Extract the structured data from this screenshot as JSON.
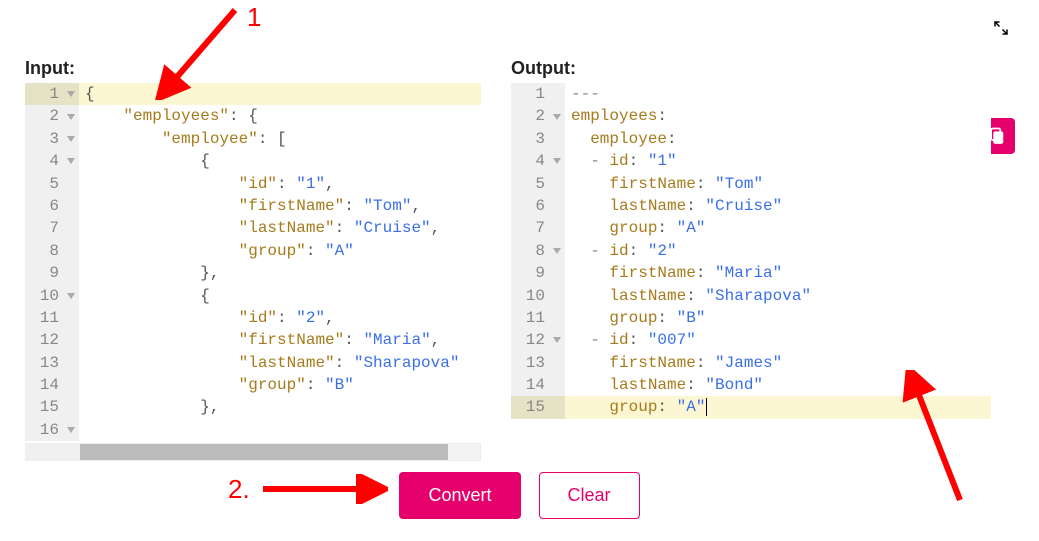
{
  "labels": {
    "input_title": "Input:",
    "output_title": "Output:",
    "convert": "Convert",
    "clear": "Clear"
  },
  "annotations": {
    "one": "1",
    "two": "2."
  },
  "input_editor": {
    "lines": [
      {
        "n": 1,
        "fold": true,
        "hl": true,
        "tokens": [
          [
            "punc",
            "{"
          ]
        ]
      },
      {
        "n": 2,
        "fold": true,
        "hl": false,
        "tokens": [
          [
            "ws",
            "    "
          ],
          [
            "key",
            "\"employees\""
          ],
          [
            "punc",
            ": {"
          ]
        ]
      },
      {
        "n": 3,
        "fold": true,
        "hl": false,
        "tokens": [
          [
            "ws",
            "        "
          ],
          [
            "key",
            "\"employee\""
          ],
          [
            "punc",
            ": ["
          ]
        ]
      },
      {
        "n": 4,
        "fold": true,
        "hl": false,
        "tokens": [
          [
            "ws",
            "            "
          ],
          [
            "punc",
            "{"
          ]
        ]
      },
      {
        "n": 5,
        "fold": false,
        "hl": false,
        "tokens": [
          [
            "ws",
            "                "
          ],
          [
            "key",
            "\"id\""
          ],
          [
            "punc",
            ": "
          ],
          [
            "str",
            "\"1\""
          ],
          [
            "punc",
            ","
          ]
        ]
      },
      {
        "n": 6,
        "fold": false,
        "hl": false,
        "tokens": [
          [
            "ws",
            "                "
          ],
          [
            "key",
            "\"firstName\""
          ],
          [
            "punc",
            ": "
          ],
          [
            "str",
            "\"Tom\""
          ],
          [
            "punc",
            ","
          ]
        ]
      },
      {
        "n": 7,
        "fold": false,
        "hl": false,
        "tokens": [
          [
            "ws",
            "                "
          ],
          [
            "key",
            "\"lastName\""
          ],
          [
            "punc",
            ": "
          ],
          [
            "str",
            "\"Cruise\""
          ],
          [
            "punc",
            ","
          ]
        ]
      },
      {
        "n": 8,
        "fold": false,
        "hl": false,
        "tokens": [
          [
            "ws",
            "                "
          ],
          [
            "key",
            "\"group\""
          ],
          [
            "punc",
            ": "
          ],
          [
            "str",
            "\"A\""
          ]
        ]
      },
      {
        "n": 9,
        "fold": false,
        "hl": false,
        "tokens": [
          [
            "ws",
            "            "
          ],
          [
            "punc",
            "},"
          ]
        ]
      },
      {
        "n": 10,
        "fold": true,
        "hl": false,
        "tokens": [
          [
            "ws",
            "            "
          ],
          [
            "punc",
            "{"
          ]
        ]
      },
      {
        "n": 11,
        "fold": false,
        "hl": false,
        "tokens": [
          [
            "ws",
            "                "
          ],
          [
            "key",
            "\"id\""
          ],
          [
            "punc",
            ": "
          ],
          [
            "str",
            "\"2\""
          ],
          [
            "punc",
            ","
          ]
        ]
      },
      {
        "n": 12,
        "fold": false,
        "hl": false,
        "tokens": [
          [
            "ws",
            "                "
          ],
          [
            "key",
            "\"firstName\""
          ],
          [
            "punc",
            ": "
          ],
          [
            "str",
            "\"Maria\""
          ],
          [
            "punc",
            ","
          ]
        ]
      },
      {
        "n": 13,
        "fold": false,
        "hl": false,
        "tokens": [
          [
            "ws",
            "                "
          ],
          [
            "key",
            "\"lastName\""
          ],
          [
            "punc",
            ": "
          ],
          [
            "str",
            "\"Sharapova\""
          ]
        ]
      },
      {
        "n": 14,
        "fold": false,
        "hl": false,
        "tokens": [
          [
            "ws",
            "                "
          ],
          [
            "key",
            "\"group\""
          ],
          [
            "punc",
            ": "
          ],
          [
            "str",
            "\"B\""
          ]
        ]
      },
      {
        "n": 15,
        "fold": false,
        "hl": false,
        "tokens": [
          [
            "ws",
            "            "
          ],
          [
            "punc",
            "},"
          ]
        ]
      },
      {
        "n": 16,
        "fold": true,
        "hl": false,
        "tokens": []
      }
    ]
  },
  "output_editor": {
    "lines": [
      {
        "n": 1,
        "fold": false,
        "hl": false,
        "tokens": [
          [
            "dash",
            "---"
          ]
        ]
      },
      {
        "n": 2,
        "fold": true,
        "hl": false,
        "tokens": [
          [
            "key",
            "employees"
          ],
          [
            "punc",
            ":"
          ]
        ]
      },
      {
        "n": 3,
        "fold": false,
        "hl": false,
        "tokens": [
          [
            "ws",
            "  "
          ],
          [
            "key",
            "employee"
          ],
          [
            "punc",
            ":"
          ]
        ]
      },
      {
        "n": 4,
        "fold": true,
        "hl": false,
        "tokens": [
          [
            "ws",
            "  "
          ],
          [
            "dash",
            "- "
          ],
          [
            "key",
            "id"
          ],
          [
            "punc",
            ": "
          ],
          [
            "str",
            "\"1\""
          ]
        ]
      },
      {
        "n": 5,
        "fold": false,
        "hl": false,
        "tokens": [
          [
            "ws",
            "    "
          ],
          [
            "key",
            "firstName"
          ],
          [
            "punc",
            ": "
          ],
          [
            "str",
            "\"Tom\""
          ]
        ]
      },
      {
        "n": 6,
        "fold": false,
        "hl": false,
        "tokens": [
          [
            "ws",
            "    "
          ],
          [
            "key",
            "lastName"
          ],
          [
            "punc",
            ": "
          ],
          [
            "str",
            "\"Cruise\""
          ]
        ]
      },
      {
        "n": 7,
        "fold": false,
        "hl": false,
        "tokens": [
          [
            "ws",
            "    "
          ],
          [
            "key",
            "group"
          ],
          [
            "punc",
            ": "
          ],
          [
            "str",
            "\"A\""
          ]
        ]
      },
      {
        "n": 8,
        "fold": true,
        "hl": false,
        "tokens": [
          [
            "ws",
            "  "
          ],
          [
            "dash",
            "- "
          ],
          [
            "key",
            "id"
          ],
          [
            "punc",
            ": "
          ],
          [
            "str",
            "\"2\""
          ]
        ]
      },
      {
        "n": 9,
        "fold": false,
        "hl": false,
        "tokens": [
          [
            "ws",
            "    "
          ],
          [
            "key",
            "firstName"
          ],
          [
            "punc",
            ": "
          ],
          [
            "str",
            "\"Maria\""
          ]
        ]
      },
      {
        "n": 10,
        "fold": false,
        "hl": false,
        "tokens": [
          [
            "ws",
            "    "
          ],
          [
            "key",
            "lastName"
          ],
          [
            "punc",
            ": "
          ],
          [
            "str",
            "\"Sharapova\""
          ]
        ]
      },
      {
        "n": 11,
        "fold": false,
        "hl": false,
        "tokens": [
          [
            "ws",
            "    "
          ],
          [
            "key",
            "group"
          ],
          [
            "punc",
            ": "
          ],
          [
            "str",
            "\"B\""
          ]
        ]
      },
      {
        "n": 12,
        "fold": true,
        "hl": false,
        "tokens": [
          [
            "ws",
            "  "
          ],
          [
            "dash",
            "- "
          ],
          [
            "key",
            "id"
          ],
          [
            "punc",
            ": "
          ],
          [
            "str",
            "\"007\""
          ]
        ]
      },
      {
        "n": 13,
        "fold": false,
        "hl": false,
        "tokens": [
          [
            "ws",
            "    "
          ],
          [
            "key",
            "firstName"
          ],
          [
            "punc",
            ": "
          ],
          [
            "str",
            "\"James\""
          ]
        ]
      },
      {
        "n": 14,
        "fold": false,
        "hl": false,
        "tokens": [
          [
            "ws",
            "    "
          ],
          [
            "key",
            "lastName"
          ],
          [
            "punc",
            ": "
          ],
          [
            "str",
            "\"Bond\""
          ]
        ]
      },
      {
        "n": 15,
        "fold": false,
        "hl": true,
        "tokens": [
          [
            "ws",
            "    "
          ],
          [
            "key",
            "group"
          ],
          [
            "punc",
            ": "
          ],
          [
            "str",
            "\"A\""
          ],
          [
            "cursor",
            ""
          ]
        ]
      }
    ]
  }
}
